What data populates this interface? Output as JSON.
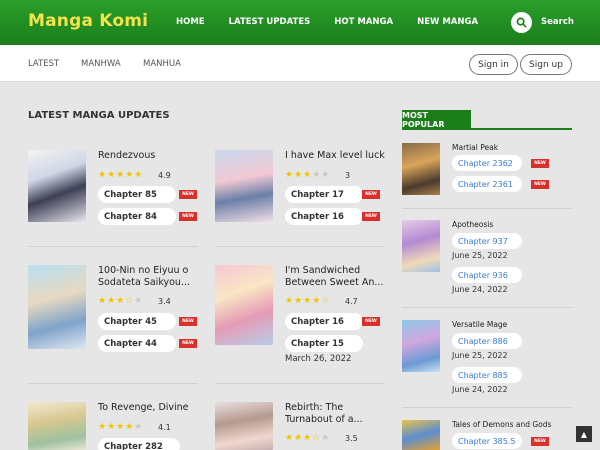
{
  "header": {
    "logo": "Manga Komi",
    "nav": [
      "HOME",
      "LATEST UPDATES",
      "HOT MANGA",
      "NEW MANGA"
    ],
    "search_label": "Search"
  },
  "subnav": {
    "items": [
      "LATEST",
      "MANHWA",
      "MANHUA"
    ],
    "signin": "Sign in",
    "signup": "Sign up"
  },
  "latest": {
    "title": "LATEST MANGA UPDATES",
    "badge": "NEW",
    "cards": [
      {
        "title": "Rendezvous",
        "rating": "4.9",
        "stars": 5,
        "chapters": [
          "Chapter 85",
          "Chapter 84"
        ]
      },
      {
        "title": "I have Max level luck",
        "rating": "3",
        "stars": 3,
        "chapters": [
          "Chapter 17",
          "Chapter 16"
        ]
      },
      {
        "title": "100-Nin no Eiyuu o Sodateta Saikyou...",
        "rating": "3.4",
        "stars": 3.5,
        "chapters": [
          "Chapter 45",
          "Chapter 44"
        ]
      },
      {
        "title": "I'm Sandwiched Between Sweet An...",
        "rating": "4.7",
        "stars": 4.5,
        "chapters": [
          "Chapter 16",
          "Chapter 15"
        ],
        "date": "March 26, 2022"
      },
      {
        "title": "To Revenge, Divine",
        "rating": "4.1",
        "stars": 4,
        "chapters": [
          "Chapter 282"
        ]
      },
      {
        "title": "Rebirth: The Turnabout of a...",
        "rating": "3.5",
        "stars": 3.5,
        "chapters": []
      }
    ]
  },
  "popular": {
    "title": "MOST POPULAR",
    "items": [
      {
        "title": "Martial Peak",
        "chapters": [
          {
            "label": "Chapter 2362",
            "new": true
          },
          {
            "label": "Chapter 2361",
            "new": true
          }
        ]
      },
      {
        "title": "Apotheosis",
        "chapters": [
          {
            "label": "Chapter 937",
            "date": "June 25, 2022"
          },
          {
            "label": "Chapter 936",
            "date": "June 24, 2022"
          }
        ]
      },
      {
        "title": "Versatile Mage",
        "chapters": [
          {
            "label": "Chapter 886",
            "date": "June 25, 2022"
          },
          {
            "label": "Chapter 885",
            "date": "June 24, 2022"
          }
        ]
      },
      {
        "title": "Tales of Demons and Gods",
        "chapters": [
          {
            "label": "Chapter 385.5",
            "new": true
          }
        ]
      }
    ]
  },
  "colors": {
    "brand": "#1b7e1b",
    "logo": "#f3e24a",
    "new_badge": "#d9302c",
    "link": "#3a7bd5"
  }
}
